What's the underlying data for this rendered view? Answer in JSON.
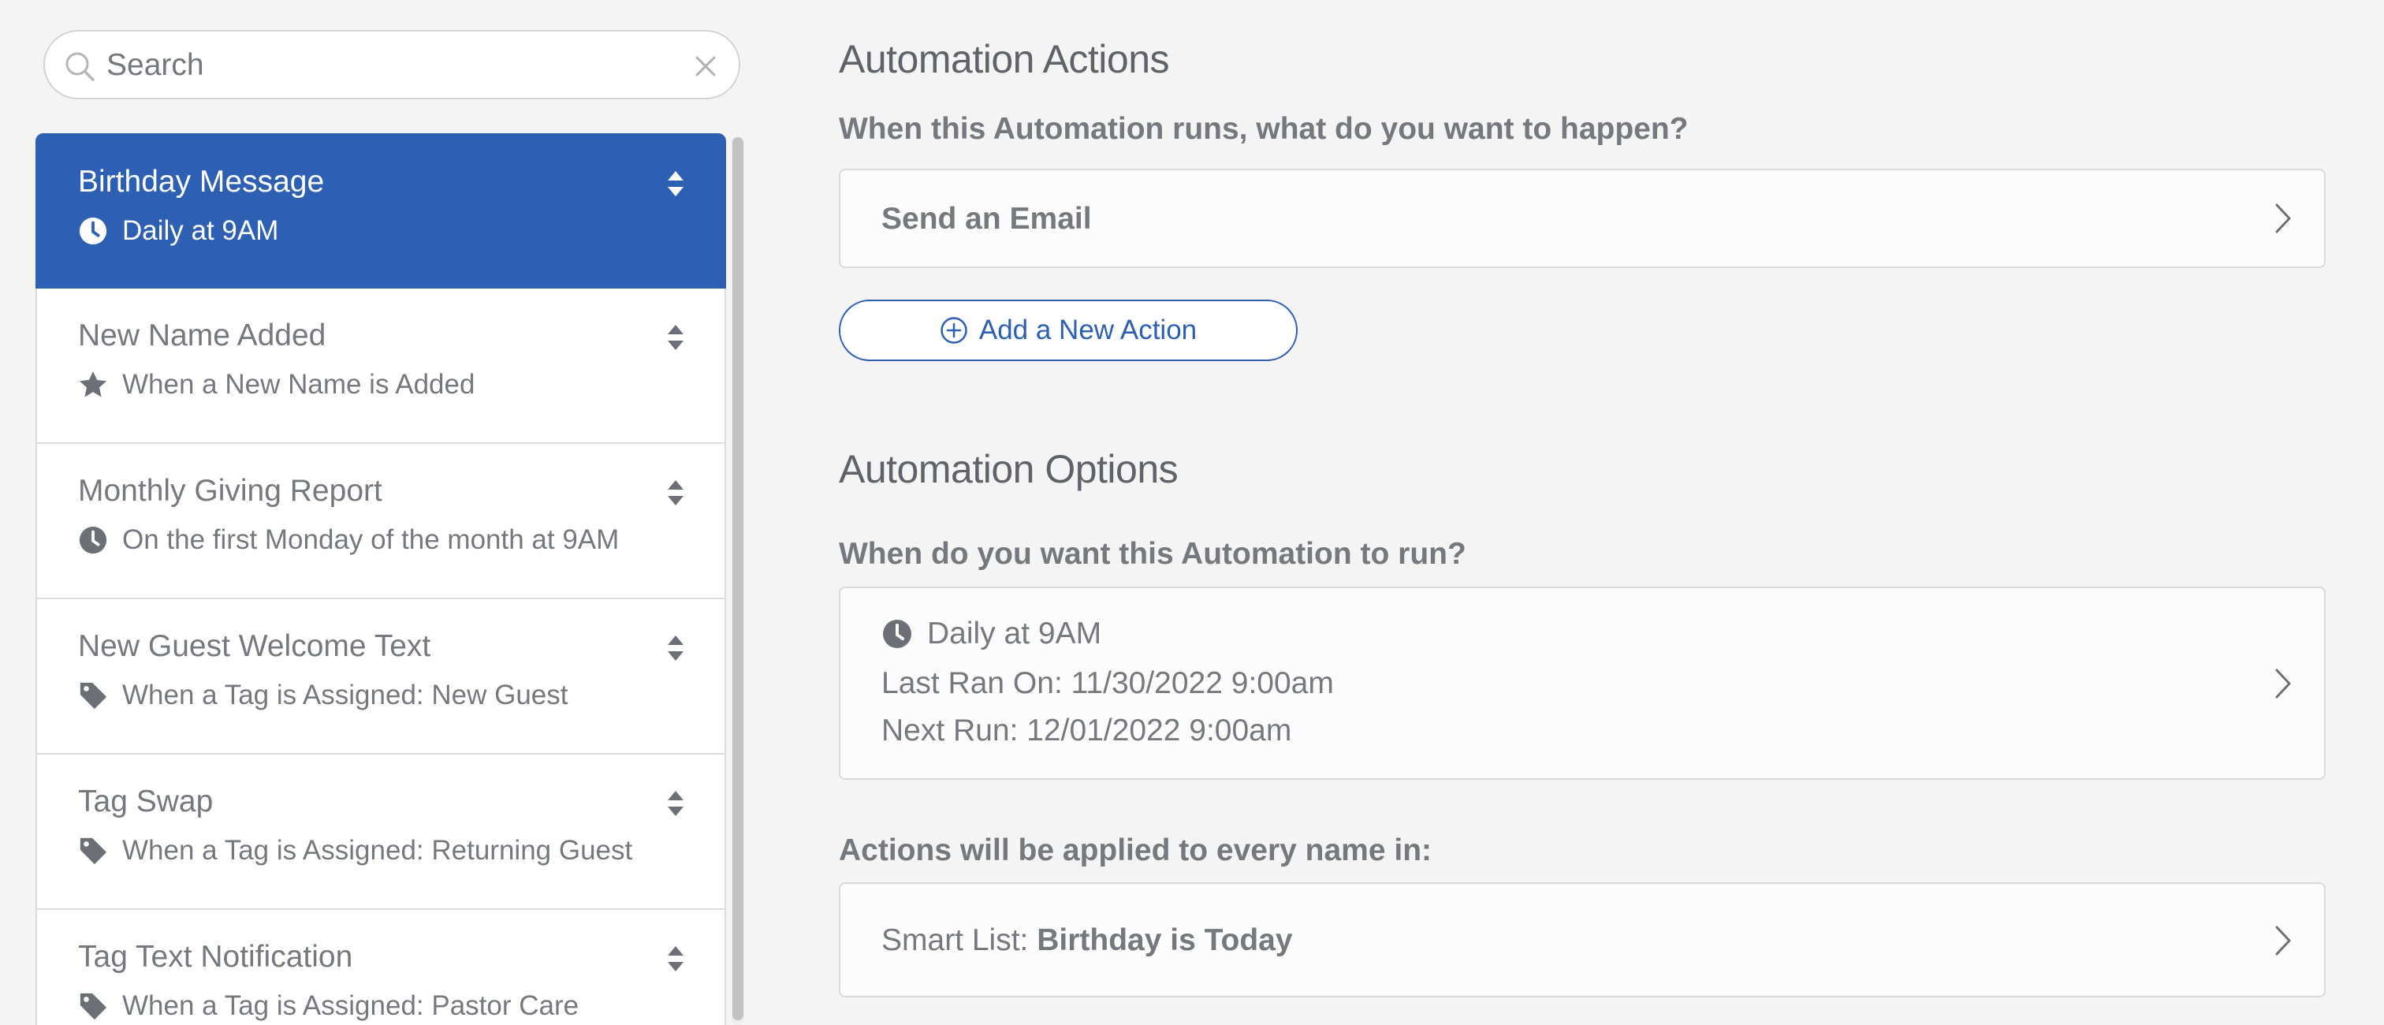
{
  "search": {
    "placeholder": "Search"
  },
  "automations": [
    {
      "title": "Birthday Message",
      "trigger_icon": "clock-icon",
      "trigger": "Daily at 9AM",
      "selected": true
    },
    {
      "title": "New Name Added",
      "trigger_icon": "star-icon",
      "trigger": "When a New Name is Added"
    },
    {
      "title": "Monthly Giving Report",
      "trigger_icon": "clock-icon",
      "trigger": "On the first Monday of the month at 9AM"
    },
    {
      "title": "New Guest Welcome Text",
      "trigger_icon": "tag-icon",
      "trigger": "When a Tag is Assigned: New Guest"
    },
    {
      "title": "Tag Swap",
      "trigger_icon": "tag-icon",
      "trigger": "When a Tag is Assigned: Returning Guest"
    },
    {
      "title": "Tag Text Notification",
      "trigger_icon": "tag-icon",
      "trigger": "When a Tag is Assigned: Pastor Care"
    }
  ],
  "actions": {
    "heading": "Automation Actions",
    "question": "When this Automation runs, what do you want to happen?",
    "items": [
      {
        "label": "Send an Email"
      }
    ],
    "add_label": "Add a New Action"
  },
  "options": {
    "heading": "Automation Options",
    "schedule_question": "When do you want this Automation to run?",
    "schedule": {
      "frequency": "Daily at 9AM",
      "last_ran": "Last Ran On: 11/30/2022 9:00am",
      "next_run": "Next Run: 12/01/2022 9:00am"
    },
    "applies_question": "Actions will be applied to every name in:",
    "smart_list": {
      "prefix": "Smart List: ",
      "name": "Birthday is Today"
    }
  },
  "colors": {
    "accent": "#2d5fb2",
    "text": "#75787d",
    "background": "#f4f4f4"
  }
}
